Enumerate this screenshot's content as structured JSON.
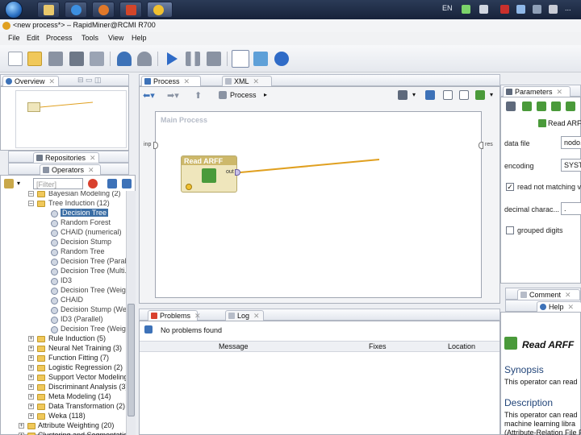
{
  "taskbar": {
    "language": "EN",
    "clock": "..."
  },
  "window": {
    "title": "<new process*> – RapidMiner@RCMI R700"
  },
  "menu": {
    "file": "File",
    "edit": "Edit",
    "process": "Process",
    "tools": "Tools",
    "view": "View",
    "help": "Help"
  },
  "left": {
    "overview_tab": "Overview",
    "repositories_tab": "Repositories",
    "operators_tab": "Operators",
    "filter_placeholder": "[Filter]",
    "tree": {
      "partial_top": "Bayesian Modeling (2)",
      "tree_induction": "Tree Induction (12)",
      "operators": [
        "Decision Tree",
        "Random Forest",
        "CHAID (numerical)",
        "Decision Stump",
        "Random Tree",
        "Decision Tree (Paral.)",
        "Decision Tree (Multi.)",
        "ID3",
        "Decision Tree (Weight)",
        "CHAID",
        "Decision Stump (Weight)",
        "ID3 (Parallel)",
        "Decision Tree (Weight)"
      ],
      "folders": [
        "Rule Induction (5)",
        "Neural Net Training (3)",
        "Function Fitting (7)",
        "Logistic Regression (2)",
        "Support Vector Modeling",
        "Discriminant Analysis (3)",
        "Meta Modeling (14)",
        "Data Transformation (2)",
        "Weka (118)"
      ],
      "bottom_folders": [
        "Attribute Weighting (20)",
        "Clustering and Segmentation"
      ]
    }
  },
  "center": {
    "process_tab": "Process",
    "xml_tab": "XML",
    "breadcrumb": "Process",
    "main_process_title": "Main Process",
    "port_inp": "inp",
    "port_res": "res",
    "operator": {
      "name": "Read ARFF",
      "port_out": "out"
    },
    "problems_tab": "Problems",
    "log_tab": "Log",
    "problems_status": "No problems found",
    "columns": {
      "message": "Message",
      "fixes": "Fixes",
      "location": "Location"
    }
  },
  "right": {
    "parameters_tab": "Parameters",
    "operator_title": "Read ARFF",
    "params": {
      "data_file_label": "data file",
      "data_file_value": "nodo...",
      "encoding_label": "encoding",
      "encoding_value": "SYST...",
      "read_not_matching_label": "read not matching v...",
      "decimal_char_label": "decimal charac...",
      "decimal_char_value": ".",
      "grouped_digits_label": "grouped digits"
    },
    "comment_tab": "Comment",
    "help_tab": "Help",
    "help": {
      "title": "Read ARFF",
      "synopsis_heading": "Synopsis",
      "synopsis_text": "This operator can read",
      "description_heading": "Description",
      "description_text_1": "This operator can read",
      "description_text_2": "machine learning libra",
      "description_text_3": "(Attribute-Relation File F"
    }
  },
  "colors": {
    "connection": "#e0a020",
    "selection": "#3b6ea5"
  }
}
